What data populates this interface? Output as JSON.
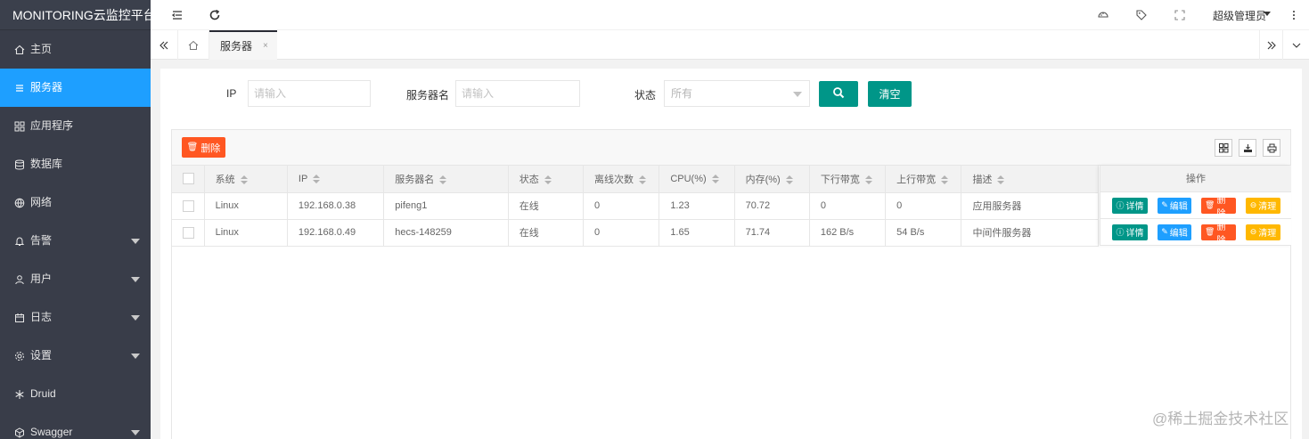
{
  "app": {
    "title": "MONITORING云监控平台"
  },
  "sidebar": {
    "items": [
      {
        "label": "主页",
        "icon": "home-icon"
      },
      {
        "label": "服务器",
        "icon": "list-icon",
        "active": true
      },
      {
        "label": "应用程序",
        "icon": "apps-icon"
      },
      {
        "label": "数据库",
        "icon": "database-icon"
      },
      {
        "label": "网络",
        "icon": "globe-icon"
      },
      {
        "label": "告警",
        "icon": "bell-icon",
        "expandable": true
      },
      {
        "label": "用户",
        "icon": "user-icon",
        "expandable": true
      },
      {
        "label": "日志",
        "icon": "calendar-icon",
        "expandable": true
      },
      {
        "label": "设置",
        "icon": "gear-icon",
        "expandable": true
      },
      {
        "label": "Druid",
        "icon": "snowflake-icon"
      },
      {
        "label": "Swagger",
        "icon": "cube-icon",
        "expandable": true
      }
    ]
  },
  "header": {
    "user": "超级管理员"
  },
  "tabs": {
    "active_label": "服务器",
    "close_glyph": "×"
  },
  "search": {
    "ip_label": "IP",
    "ip_placeholder": "请输入",
    "name_label": "服务器名",
    "name_placeholder": "请输入",
    "status_label": "状态",
    "status_value": "所有",
    "clear_label": "清空"
  },
  "toolbar": {
    "delete_label": "删除"
  },
  "table": {
    "columns": [
      "系统",
      "IP",
      "服务器名",
      "状态",
      "离线次数",
      "CPU(%)",
      "内存(%)",
      "下行带宽",
      "上行带宽",
      "描述"
    ],
    "ops_header": "操作",
    "rows": [
      [
        "Linux",
        "192.168.0.38",
        "pifeng1",
        "在线",
        "0",
        "1.23",
        "70.72",
        "0",
        "0",
        "应用服务器"
      ],
      [
        "Linux",
        "192.168.0.49",
        "hecs-148259",
        "在线",
        "0",
        "1.65",
        "71.74",
        "162 B/s",
        "54 B/s",
        "中间件服务器"
      ]
    ],
    "ops": {
      "detail": "详情",
      "edit": "编辑",
      "delete": "删除",
      "clear": "清理"
    }
  },
  "watermark": "@稀土掘金技术社区",
  "colors": {
    "sidebar_bg": "#393D49",
    "active": "#1E9FFF",
    "primary": "#009688",
    "danger": "#FF5722",
    "warm": "#FFB800"
  }
}
